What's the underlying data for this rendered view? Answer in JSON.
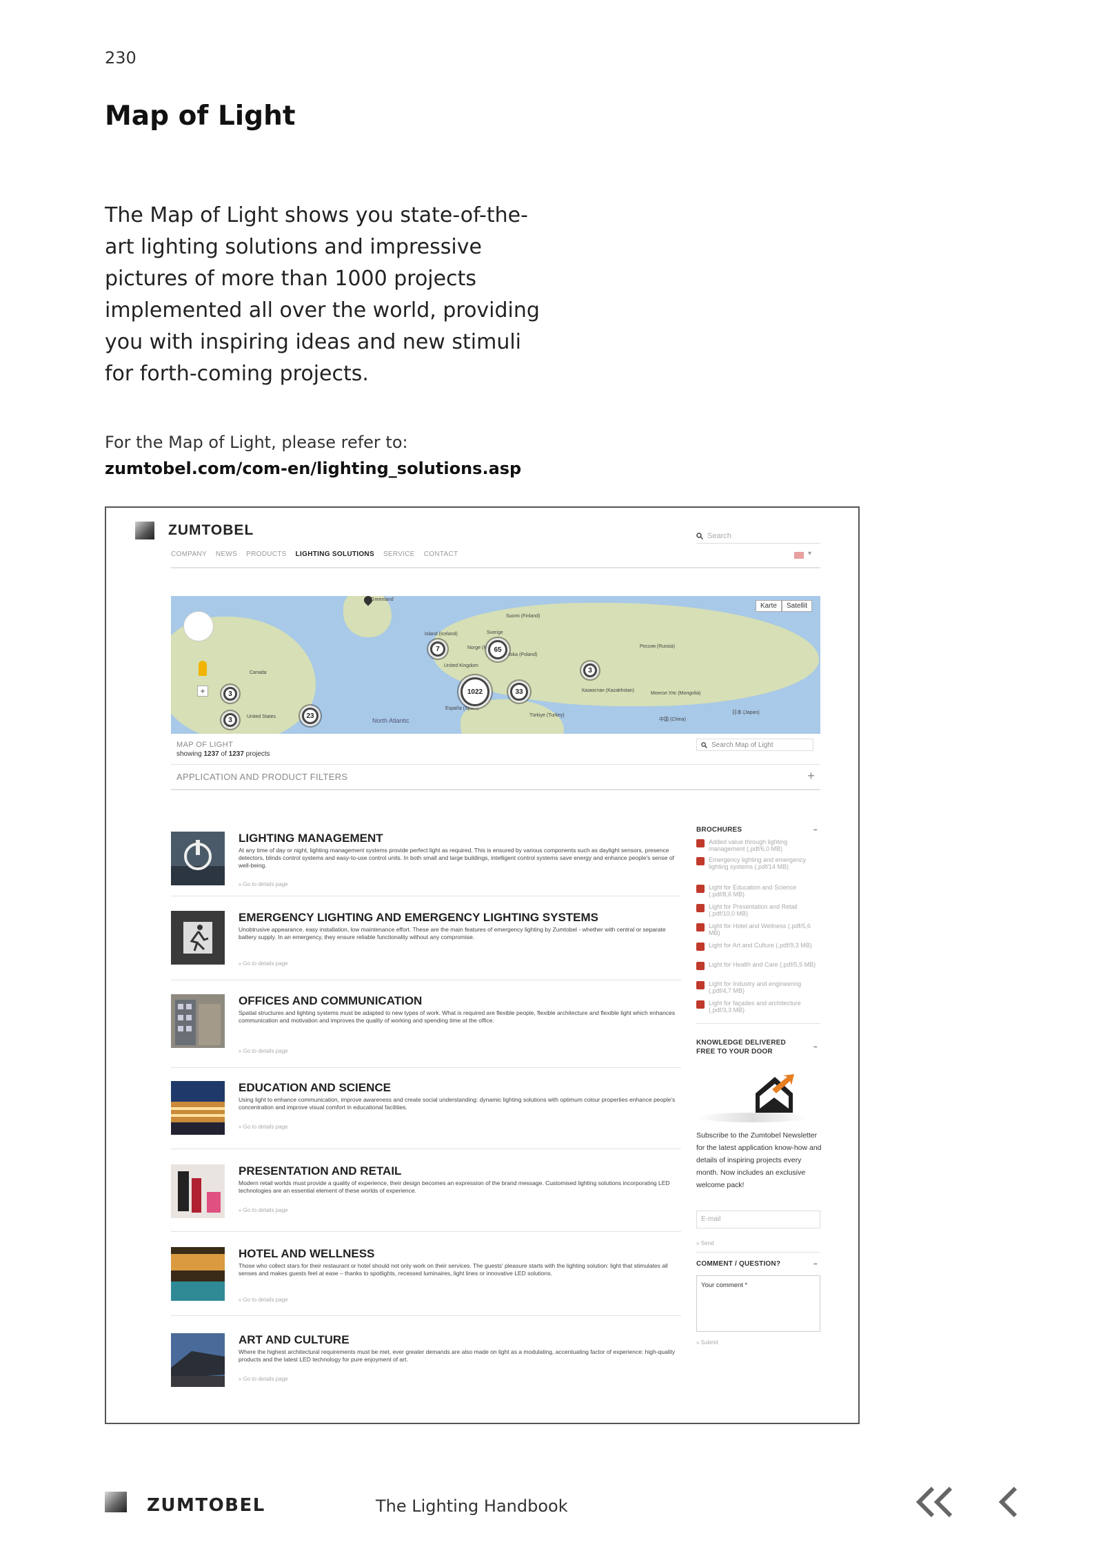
{
  "page": {
    "number": "230",
    "title": "Map of Light",
    "intro": "The Map of Light shows you state-of-the-art lighting solutions and impressive pictures of more than 1000 projects implemented all over the world, providing you with inspiring ideas and new stimuli for forth-coming projects.",
    "refer_label": "For the Map of Light, please refer to:",
    "refer_url": "zumtobel.com/com-en/lighting_solutions.asp"
  },
  "screenshot": {
    "logo": "ZUMTOBEL",
    "nav": [
      "COMPANY",
      "NEWS",
      "PRODUCTS",
      "LIGHTING SOLUTIONS",
      "SERVICE",
      "CONTACT"
    ],
    "search_placeholder": "Search",
    "map": {
      "type_buttons": [
        "Karte",
        "Satellit"
      ],
      "clusters": [
        "7",
        "65",
        "1022",
        "33",
        "3",
        "3",
        "3",
        "23"
      ],
      "places": [
        "Canada",
        "United States",
        "North Atlantic",
        "Island (Iceland)",
        "Sverige",
        "Suomi (Finland)",
        "Norge (Norway)",
        "United Kingdom",
        "Polska (Poland)",
        "España (Spain)",
        "Türkiye (Turkey)",
        "Россия (Russia)",
        "Казахстан (Kazakhstan)",
        "Монгол Улс (Mongolia)",
        "中国 (China)",
        "日本 (Japan)",
        "Greenland"
      ]
    },
    "map_of_light": {
      "title": "MAP OF LIGHT",
      "count_prefix": "showing",
      "count_shown": "1237",
      "count_of": "of",
      "count_total": "1237",
      "count_suffix": "projects",
      "search_placeholder": "Search Map of Light"
    },
    "filters_label": "APPLICATION AND PRODUCT FILTERS",
    "filters_toggle": "+",
    "detail_link": "» Go to details page",
    "solutions": [
      {
        "title": "LIGHTING MANAGEMENT",
        "text": "At any time of day or night, lighting management systems provide perfect light as required. This is ensured by various components such as daylight sensors, presence detectors, blinds control systems and easy-to-use control units. In both small and large buildings, intelligent control systems save energy and enhance people's sense of well-being."
      },
      {
        "title": "EMERGENCY LIGHTING AND EMERGENCY LIGHTING SYSTEMS",
        "text": "Unobtrusive appearance, easy installation, low maintenance effort. These are the main features of emergency lighting by Zumtobel - whether with central or separate battery supply. In an emergency, they ensure reliable functionality without any compromise."
      },
      {
        "title": "OFFICES AND COMMUNICATION",
        "text": "Spatial structures and lighting systems must be adapted to new types of work. What is required are flexible people, flexible architecture and flexible light which enhances communication and motivation and improves the quality of working and spending time at the office."
      },
      {
        "title": "EDUCATION AND SCIENCE",
        "text": "Using light to enhance communication, improve awareness and create social understanding: dynamic lighting solutions with optimum colour properties enhance people's concentration and improve visual comfort in educational facilities."
      },
      {
        "title": "PRESENTATION AND RETAIL",
        "text": "Modern retail worlds must provide a quality of experience, their design becomes an expression of the brand message. Customised lighting solutions incorporating LED technologies are an essential element of these worlds of experience."
      },
      {
        "title": "HOTEL AND WELLNESS",
        "text": "Those who collect stars for their restaurant or hotel should not only work on their services. The guests' pleasure starts with the lighting solution: light that stimulates all senses and makes guests feel at ease – thanks to spotlights, recessed luminaires, light lines or innovative LED solutions."
      },
      {
        "title": "ART AND CULTURE",
        "text": "Where the highest architectural requirements must be met, ever greater demands are also made on light as a modulating, accentuating factor of experience: high-quality products and the latest LED technology for pure enjoyment of art."
      }
    ],
    "sidebar": {
      "brochures_title": "BROCHURES",
      "toggle": "–",
      "brochures": [
        "Added value through lighting management (.pdf/6,0 MB)",
        "Emergency lighting and emergency lighting systems (.pdf/14 MB)",
        "Light for Education and Science (.pdf/8,6 MB)",
        "Light for Presentation and Retail (.pdf/10,0 MB)",
        "Light for Hotel and Wellness (.pdf/5,6 MB)",
        "Light for Art and Culture (.pdf/9,3 MB)",
        "Light for Health and Care (.pdf/5,5 MB)",
        "Light for Industry and engineering (.pdf/4,7 MB)",
        "Light for façades and architecture (.pdf/3,3 MB)"
      ],
      "newsletter_title_1": "KNOWLEDGE DELIVERED",
      "newsletter_title_2": "FREE TO YOUR DOOR",
      "newsletter_text": "Subscribe to the Zumtobel Newsletter for the latest application know-how and details of inspiring projects every month. Now includes an exclusive welcome pack!",
      "email_placeholder": "E-mail",
      "send": "» Send",
      "comment_title": "COMMENT / QUESTION?",
      "comment_placeholder": "Your comment *",
      "submit": "» Submit"
    }
  },
  "footer": {
    "logo": "ZUMTOBEL",
    "title": "The Lighting Handbook"
  },
  "colors": {
    "map_water": "#a8c9e8",
    "map_land": "#d6dfb5",
    "pdf_red": "#c0392b",
    "mail_orange": "#e67e22"
  },
  "icons": [
    "search-icon",
    "pdf-icon",
    "mail-icon",
    "first-page-icon",
    "previous-page-icon"
  ]
}
